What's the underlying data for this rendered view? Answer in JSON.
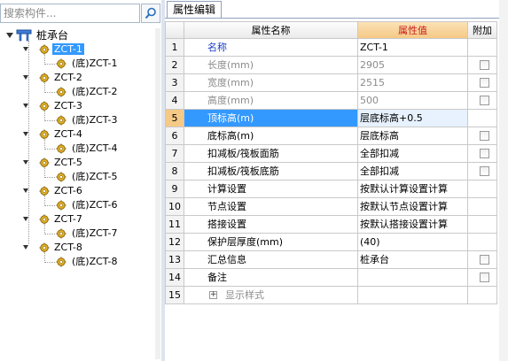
{
  "search": {
    "placeholder": "搜索构件..."
  },
  "tree": {
    "root": {
      "label": "桩承台"
    },
    "groups": [
      {
        "label": "ZCT-1",
        "child": "(底)ZCT-1"
      },
      {
        "label": "ZCT-2",
        "child": "(底)ZCT-2"
      },
      {
        "label": "ZCT-3",
        "child": "(底)ZCT-3"
      },
      {
        "label": "ZCT-4",
        "child": "(底)ZCT-4"
      },
      {
        "label": "ZCT-5",
        "child": "(底)ZCT-5"
      },
      {
        "label": "ZCT-6",
        "child": "(底)ZCT-6"
      },
      {
        "label": "ZCT-7",
        "child": "(底)ZCT-7"
      },
      {
        "label": "ZCT-8",
        "child": "(底)ZCT-8"
      }
    ]
  },
  "tabs": {
    "properties": "属性编辑"
  },
  "grid": {
    "headers": {
      "name": "属性名称",
      "value": "属性值",
      "extra": "附加"
    },
    "rows": [
      {
        "num": "1",
        "name": "名称",
        "value": "ZCT-1"
      },
      {
        "num": "2",
        "name": "长度(mm)",
        "value": "2905"
      },
      {
        "num": "3",
        "name": "宽度(mm)",
        "value": "2515"
      },
      {
        "num": "4",
        "name": "高度(mm)",
        "value": "500"
      },
      {
        "num": "5",
        "name": "顶标高(m)",
        "value": "层底标高+0.5"
      },
      {
        "num": "6",
        "name": "底标高(m)",
        "value": "层底标高"
      },
      {
        "num": "7",
        "name": "扣减板/筏板面筋",
        "value": "全部扣减"
      },
      {
        "num": "8",
        "name": "扣减板/筏板底筋",
        "value": "全部扣减"
      },
      {
        "num": "9",
        "name": "计算设置",
        "value": "按默认计算设置计算"
      },
      {
        "num": "10",
        "name": "节点设置",
        "value": "按默认节点设置计算"
      },
      {
        "num": "11",
        "name": "搭接设置",
        "value": "按默认搭接设置计算"
      },
      {
        "num": "12",
        "name": "保护层厚度(mm)",
        "value": "(40)"
      },
      {
        "num": "13",
        "name": "汇总信息",
        "value": "桩承台"
      },
      {
        "num": "14",
        "name": "备注",
        "value": ""
      },
      {
        "num": "15",
        "name": "显示样式",
        "value": "",
        "expander": "+"
      }
    ]
  },
  "colors": {
    "selection": "#3399ff",
    "value_header": "#f5c986",
    "value_header_text": "#c81e1e",
    "name_link": "#1a3fc4",
    "disabled_text": "#8c8c8c"
  },
  "icons": {
    "search": "search-icon",
    "root": "pile-cap-icon",
    "component": "gear-icon",
    "expander": "triangle-down-icon"
  }
}
